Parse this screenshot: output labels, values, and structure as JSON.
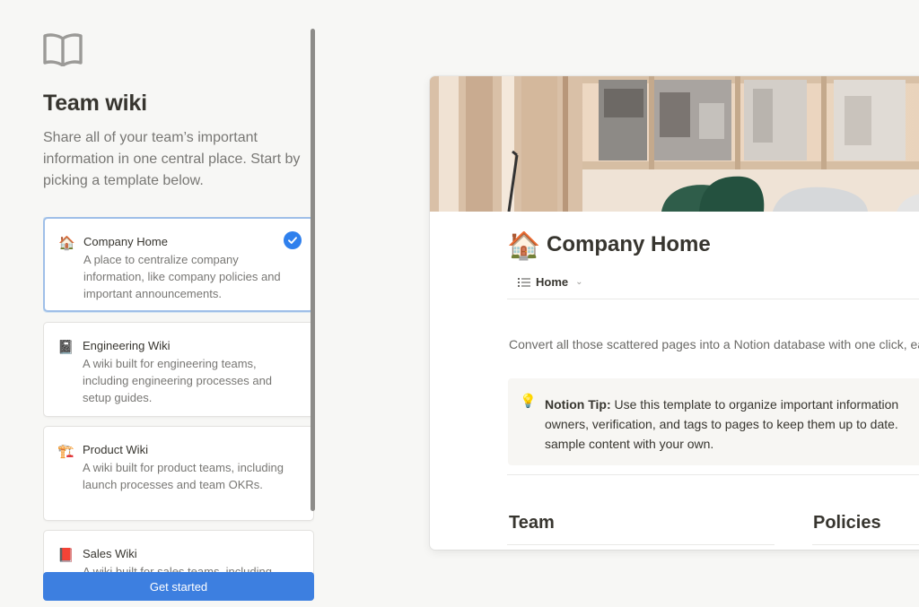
{
  "panel": {
    "title": "Team wiki",
    "description": "Share all of your team’s important information in one central place. Start by picking a template below."
  },
  "templates": [
    {
      "emoji": "🏠",
      "name": "Company Home",
      "description": "A place to centralize company information, like company policies and important announcements.",
      "selected": true
    },
    {
      "emoji": "📓",
      "name": "Engineering Wiki",
      "description": "A wiki built for engineering teams, including engineering processes and setup guides.",
      "selected": false
    },
    {
      "emoji": "🏗️",
      "name": "Product Wiki",
      "description": "A wiki built for product teams, including launch processes and team OKRs.",
      "selected": false
    },
    {
      "emoji": "📕",
      "name": "Sales Wiki",
      "description": "A wiki built for sales teams, including",
      "selected": false
    }
  ],
  "cta": {
    "label": "Get started"
  },
  "preview": {
    "emoji": "🏠",
    "title": "Company Home",
    "view_tab": "Home",
    "intro": "Convert all those scattered pages into a Notion database with one click, easy-to-read page format.",
    "callout": {
      "icon": "💡",
      "label": "Notion Tip:",
      "text": "Use this template to organize important information",
      "line2": "owners, verification, and tags to pages to keep them up to date.",
      "line3": "sample content with your own."
    },
    "sections": [
      "Team",
      "Policies"
    ]
  },
  "colors": {
    "accent": "#3d7fe0",
    "selected_border": "#9fbfe8",
    "background": "#f7f7f5"
  },
  "icons": {
    "header": "open-book-icon",
    "check": "check-circle-icon",
    "view": "list-icon",
    "chevron": "chevron-down-icon"
  }
}
